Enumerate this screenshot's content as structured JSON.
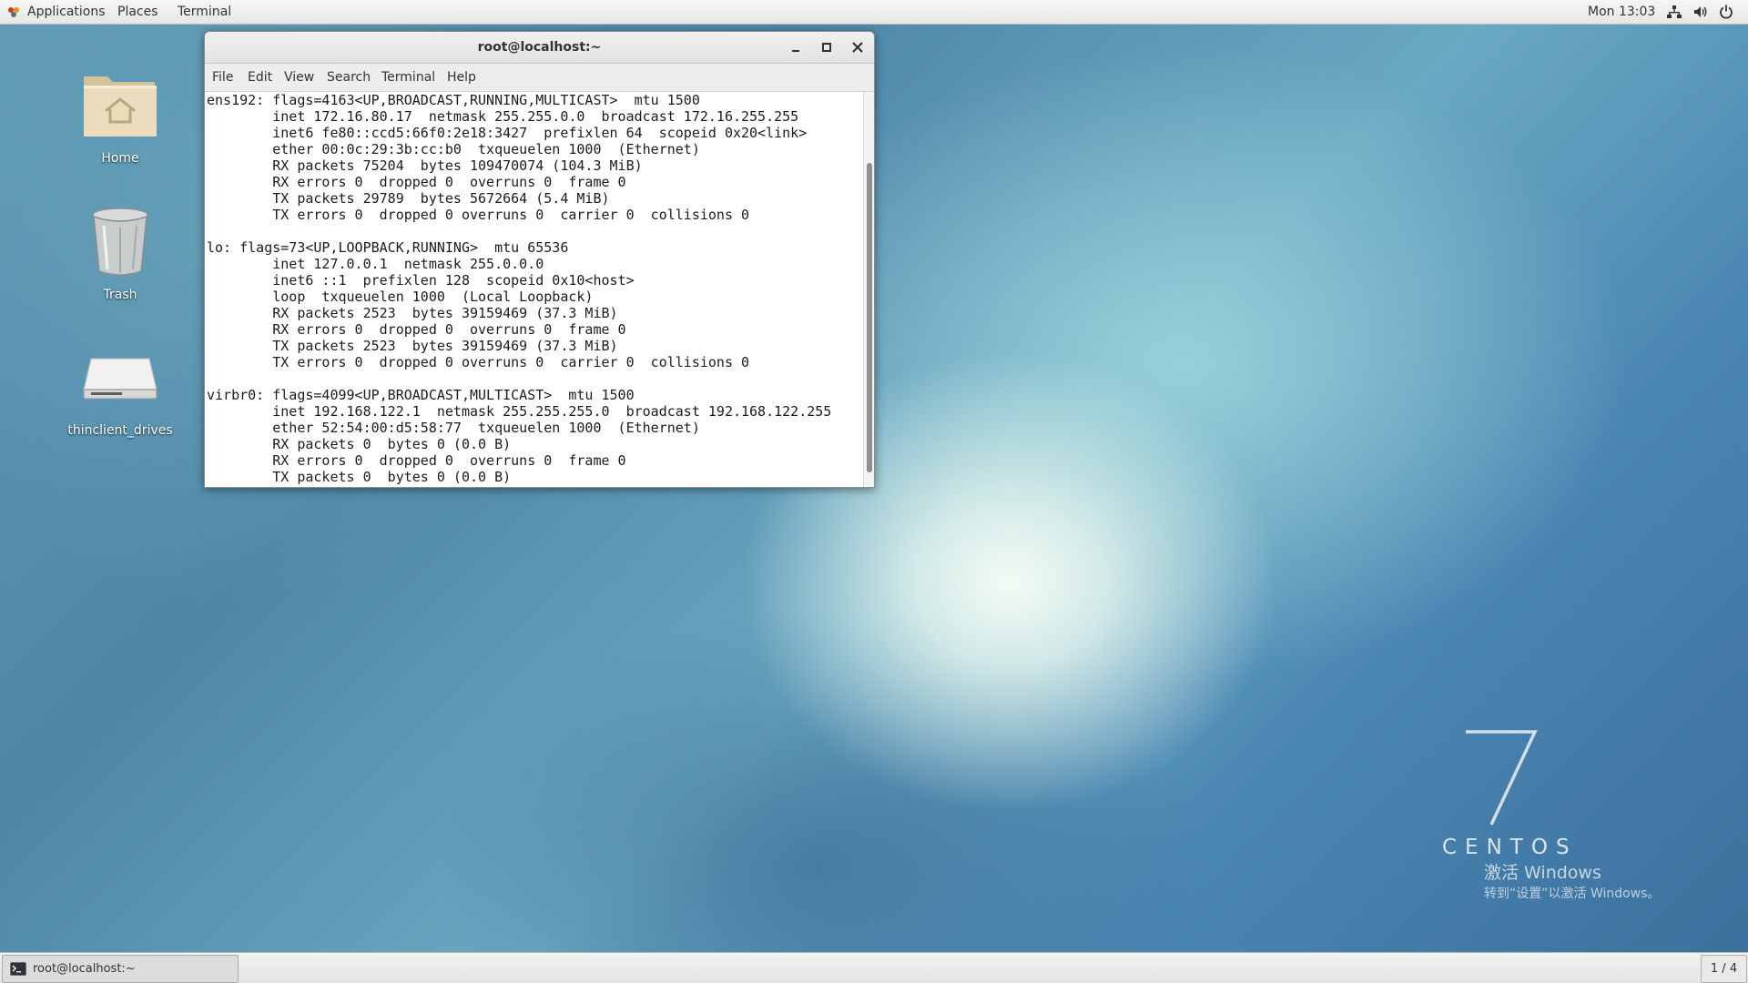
{
  "topbar": {
    "applications": "Applications",
    "places": "Places",
    "terminal": "Terminal",
    "clock": "Mon 13:03"
  },
  "desktop": {
    "icons": [
      {
        "label": "Home",
        "icon": "home-folder-icon"
      },
      {
        "label": "Trash",
        "icon": "trash-icon"
      },
      {
        "label": "thinclient_drives",
        "icon": "drive-icon"
      }
    ]
  },
  "window": {
    "title": "root@localhost:~",
    "menu": [
      "File",
      "Edit",
      "View",
      "Search",
      "Terminal",
      "Help"
    ],
    "lines": [
      "ens192: flags=4163<UP,BROADCAST,RUNNING,MULTICAST>  mtu 1500",
      "        inet 172.16.80.17  netmask 255.255.0.0  broadcast 172.16.255.255",
      "        inet6 fe80::ccd5:66f0:2e18:3427  prefixlen 64  scopeid 0x20<link>",
      "        ether 00:0c:29:3b:cc:b0  txqueuelen 1000  (Ethernet)",
      "        RX packets 75204  bytes 109470074 (104.3 MiB)",
      "        RX errors 0  dropped 0  overruns 0  frame 0",
      "        TX packets 29789  bytes 5672664 (5.4 MiB)",
      "        TX errors 0  dropped 0 overruns 0  carrier 0  collisions 0",
      "",
      "lo: flags=73<UP,LOOPBACK,RUNNING>  mtu 65536",
      "        inet 127.0.0.1  netmask 255.0.0.0",
      "        inet6 ::1  prefixlen 128  scopeid 0x10<host>",
      "        loop  txqueuelen 1000  (Local Loopback)",
      "        RX packets 2523  bytes 39159469 (37.3 MiB)",
      "        RX errors 0  dropped 0  overruns 0  frame 0",
      "        TX packets 2523  bytes 39159469 (37.3 MiB)",
      "        TX errors 0  dropped 0 overruns 0  carrier 0  collisions 0",
      "",
      "virbr0: flags=4099<UP,BROADCAST,MULTICAST>  mtu 1500",
      "        inet 192.168.122.1  netmask 255.255.255.0  broadcast 192.168.122.255",
      "        ether 52:54:00:d5:58:77  txqueuelen 1000  (Ethernet)",
      "        RX packets 0  bytes 0 (0.0 B)",
      "        RX errors 0  dropped 0  overruns 0  frame 0",
      "        TX packets 0  bytes 0 (0.0 B)"
    ]
  },
  "watermark": {
    "centos": "CENTOS",
    "activate_title": "激活 Windows",
    "activate_hint": "转到“设置”以激活 Windows。"
  },
  "bottombar": {
    "task_label": "root@localhost:~",
    "workspace": "1 / 4"
  }
}
